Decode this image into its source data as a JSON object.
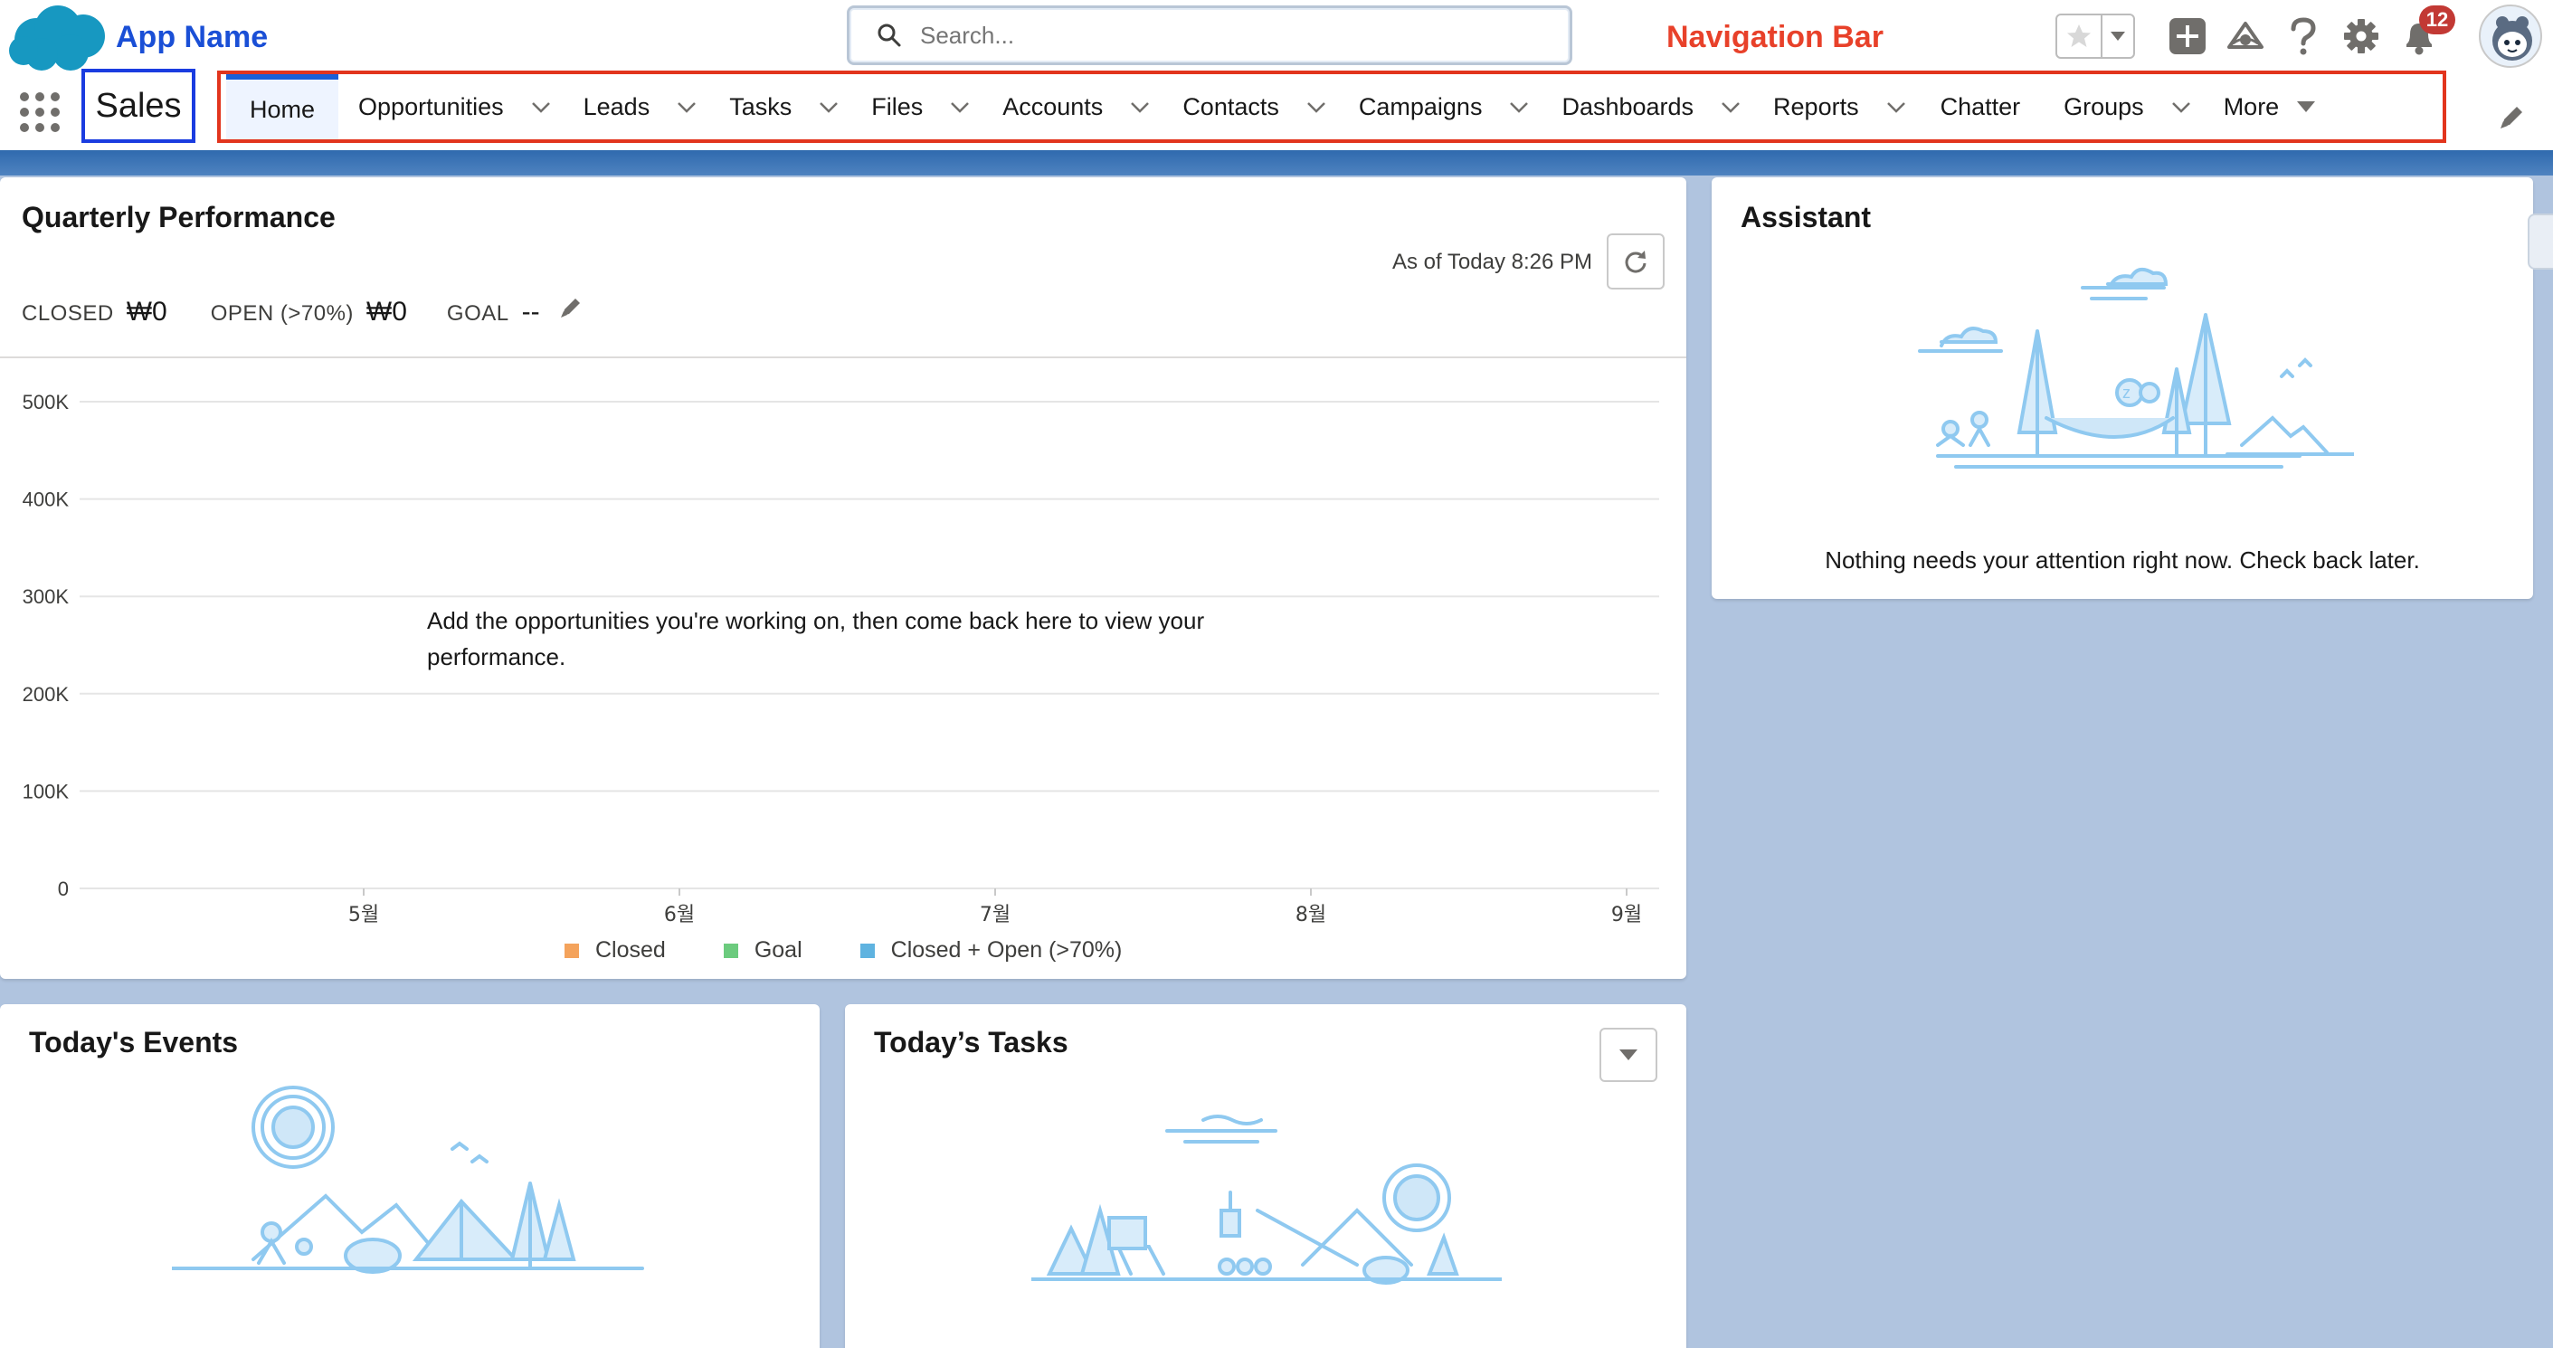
{
  "annotations": {
    "app_name": "App Name",
    "navigation_bar": "Navigation Bar"
  },
  "search": {
    "placeholder": "Search..."
  },
  "header": {
    "notification_count": "12",
    "icons": [
      "star-icon",
      "chevron-down-icon",
      "add-icon",
      "trailhead-icon",
      "help-icon",
      "gear-icon",
      "bell-icon",
      "avatar"
    ]
  },
  "app": {
    "name": "Sales"
  },
  "nav": {
    "items": [
      {
        "label": "Home",
        "active": true,
        "dropdown": false
      },
      {
        "label": "Opportunities",
        "dropdown": true
      },
      {
        "label": "Leads",
        "dropdown": true
      },
      {
        "label": "Tasks",
        "dropdown": true
      },
      {
        "label": "Files",
        "dropdown": true
      },
      {
        "label": "Accounts",
        "dropdown": true
      },
      {
        "label": "Contacts",
        "dropdown": true
      },
      {
        "label": "Campaigns",
        "dropdown": true
      },
      {
        "label": "Dashboards",
        "dropdown": true
      },
      {
        "label": "Reports",
        "dropdown": true
      },
      {
        "label": "Chatter",
        "dropdown": false
      },
      {
        "label": "Groups",
        "dropdown": true
      }
    ],
    "more_label": "More"
  },
  "quarterly": {
    "title": "Quarterly Performance",
    "as_of": "As of Today 8:26 PM",
    "closed_label": "CLOSED",
    "closed_value": "₩0",
    "open_label": "OPEN (>70%)",
    "open_value": "₩0",
    "goal_label": "GOAL",
    "goal_value": "--",
    "empty_message": "Add the opportunities you're working on, then come back here to view your performance."
  },
  "chart_data": {
    "type": "line",
    "y_ticks": [
      "500K",
      "400K",
      "300K",
      "200K",
      "100K",
      "0"
    ],
    "x_ticks": [
      "5월",
      "6월",
      "7월",
      "8월",
      "9월"
    ],
    "ylim": [
      0,
      500000
    ],
    "grid": true,
    "legend_placement": "bottom",
    "series": [
      {
        "name": "Closed",
        "color": "#f4a35c",
        "values": []
      },
      {
        "name": "Goal",
        "color": "#6ccb7e",
        "values": []
      },
      {
        "name": "Closed + Open (>70%)",
        "color": "#5fb3e0",
        "values": []
      }
    ]
  },
  "assistant": {
    "title": "Assistant",
    "message": "Nothing needs your attention right now. Check back later."
  },
  "events": {
    "title": "Today's Events"
  },
  "tasks": {
    "title": "Today’s Tasks"
  },
  "colors": {
    "brand_blue": "#1b5fd6",
    "annotation_blue": "#1a3ce0",
    "annotation_red": "#e2351d",
    "illustration": "#8fc9f0",
    "background": "#b0c4df"
  }
}
